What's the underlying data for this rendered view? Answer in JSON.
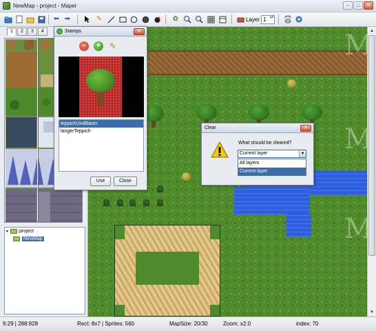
{
  "window": {
    "title": "NewMap - project - Maper",
    "minimize": "–",
    "maximize": "□",
    "close": "✕"
  },
  "toolbar": {
    "layer_label": "Layer",
    "layer_value": "1",
    "icons": [
      "open-file-icon",
      "new-file-icon",
      "folder-icon",
      "save-icon",
      "undo-icon",
      "redo-icon",
      "select-cursor-icon",
      "pencil-icon",
      "line-icon",
      "rectangle-icon",
      "ellipse-icon",
      "fill-icon",
      "bucket-icon",
      "stamp-icon",
      "zoom-in-icon",
      "zoom-out-icon",
      "grid-icon",
      "layers-icon",
      "database-icon",
      "settings-icon"
    ]
  },
  "tileset": {
    "tabs": [
      "1",
      "2",
      "3",
      "4"
    ],
    "active_tab": "1"
  },
  "project_tree": {
    "root": "project",
    "child": "NewMap"
  },
  "stamps": {
    "title": "Stamps",
    "items": [
      "teppichUndBaum",
      "langerTeppich"
    ],
    "selected": "teppichUndBaum",
    "use_label": "Use",
    "close_label": "Close"
  },
  "clear_dialog": {
    "title": "Clear",
    "question": "What should be cleared?",
    "selected": "Current layer",
    "options": [
      "All layers",
      "Current layer"
    ]
  },
  "status": {
    "coords": "9:29 | 288:928",
    "rect": "Rect: 8x7 | Sprites: 560",
    "mapsize": "MapSize: 20/30",
    "zoom": "Zoom: x2.0",
    "index": "index: 70"
  },
  "colors": {
    "grass": "#4f8a2b",
    "path": "#9b6a3a",
    "water": "#2f5fe0",
    "sand": "#e3c88a",
    "selection": "#3a6ea8"
  }
}
